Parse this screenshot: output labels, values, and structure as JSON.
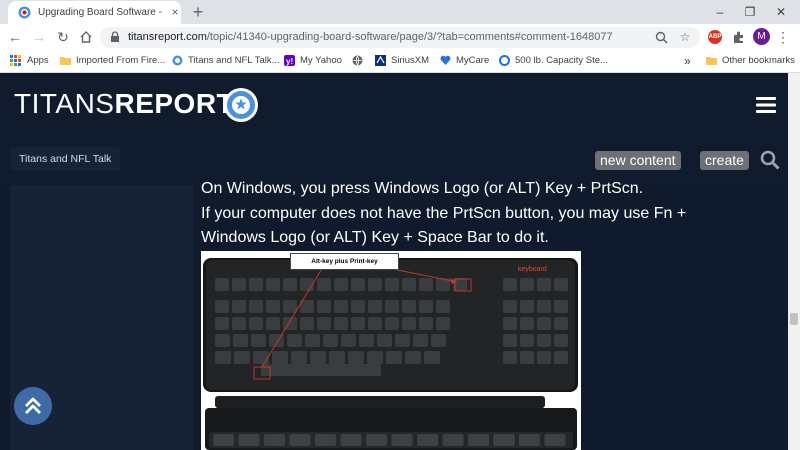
{
  "browser": {
    "tab_title": "Upgrading Board Software - Pag",
    "tab_close": "×",
    "new_tab": "+",
    "window_controls": {
      "minimize": "–",
      "restore": "❐",
      "close": "✕"
    },
    "url_host": "titansreport.com",
    "url_path": "/topic/41340-upgrading-board-software/page/3/?tab=comments#comment-1648077",
    "avatar_letter": "M",
    "abp_label": "ABP",
    "bookmarks": [
      {
        "label": "Apps",
        "icon": "apps-grid-icon"
      },
      {
        "label": "Imported From Fire...",
        "icon": "folder-icon"
      },
      {
        "label": "Titans and NFL Talk...",
        "icon": "titans-favicon"
      },
      {
        "label": "My Yahoo",
        "icon": "yahoo-icon"
      },
      {
        "label": "",
        "icon": "globe-icon"
      },
      {
        "label": "SiriusXM",
        "icon": "siriusxm-icon"
      },
      {
        "label": "MyCare",
        "icon": "heart-icon"
      },
      {
        "label": "500 lb. Capacity Ste...",
        "icon": "blue-circle-icon"
      }
    ],
    "bookmarks_overflow": "»",
    "other_bookmarks": "Other bookmarks"
  },
  "site": {
    "logo_light": "TITANS",
    "logo_bold": "REPORT",
    "breadcrumb": "Titans and NFL Talk",
    "new_content_label": "new content",
    "create_label": "create"
  },
  "post": {
    "lines": [
      "On Windows, you press Windows Logo (or ALT) Key + PrtScn.",
      "If your computer does not have the PrtScn button, you may use Fn +",
      "Windows Logo (or ALT) Key + Space Bar to do it."
    ],
    "image_callout": "Alt-key plus Print-key",
    "keyboard_brand": "keyboard"
  },
  "colors": {
    "site_bg": "#101b2d",
    "accent_blue": "#3e6aa5",
    "button_gray": "#6c6f73"
  }
}
